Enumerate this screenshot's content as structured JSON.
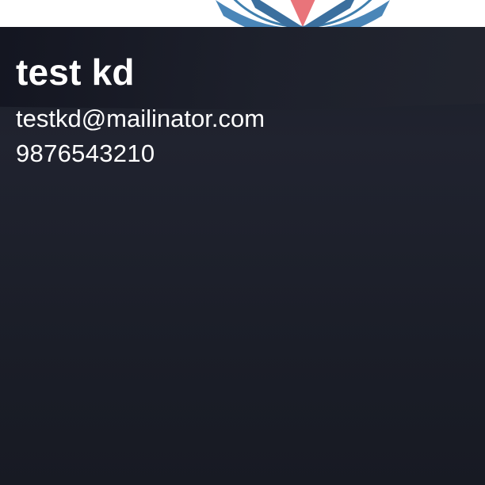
{
  "profile": {
    "name": "test kd",
    "email": "testkd@mailinator.com",
    "phone": "9876543210"
  },
  "colors": {
    "card_background": "#1d202b",
    "text": "#ffffff",
    "logo_blue": "#4a86b8",
    "logo_pink": "#e9747a"
  },
  "icons": {
    "avatar": "profile-logo-icon"
  }
}
